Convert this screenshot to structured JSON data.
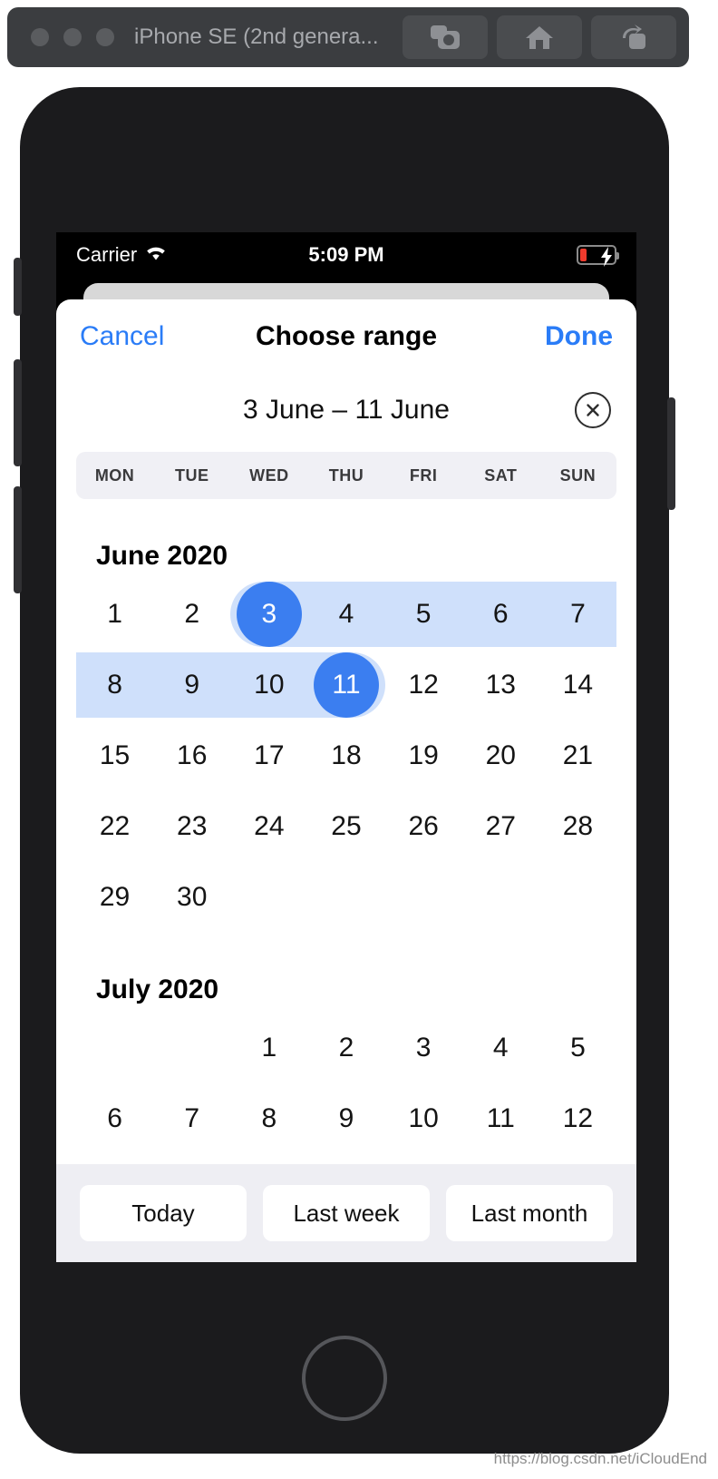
{
  "simulator": {
    "device_title": "iPhone SE (2nd genera...",
    "toolbar_buttons": [
      {
        "name": "screenshot-button",
        "icon": "camera-icon"
      },
      {
        "name": "home-button",
        "icon": "home-icon"
      },
      {
        "name": "rotate-button",
        "icon": "rotate-icon"
      }
    ]
  },
  "status_bar": {
    "carrier": "Carrier",
    "wifi_icon": "wifi-icon",
    "time": "5:09 PM",
    "battery_icon": "battery-charging-icon",
    "battery_color": "#f03b2d"
  },
  "modal": {
    "cancel_label": "Cancel",
    "title": "Choose range",
    "done_label": "Done",
    "range_text": "3 June – 11 June",
    "clear_icon": "close-circle-icon",
    "weekdays": [
      "MON",
      "TUE",
      "WED",
      "THU",
      "FRI",
      "SAT",
      "SUN"
    ],
    "accent_color": "#3b7ef0",
    "range_band_color": "#cfe0fb",
    "link_color": "#2a7cf7",
    "months": [
      {
        "title": "June 2020",
        "lead_blanks": 0,
        "weeks": [
          {
            "days": [
              "1",
              "2",
              "3",
              "4",
              "5",
              "6",
              "7"
            ],
            "band_start": 2,
            "band_end": 6
          },
          {
            "days": [
              "8",
              "9",
              "10",
              "11",
              "12",
              "13",
              "14"
            ],
            "band_start": 0,
            "band_end": 3
          },
          {
            "days": [
              "15",
              "16",
              "17",
              "18",
              "19",
              "20",
              "21"
            ]
          },
          {
            "days": [
              "22",
              "23",
              "24",
              "25",
              "26",
              "27",
              "28"
            ]
          },
          {
            "days": [
              "29",
              "30",
              "",
              "",
              "",
              "",
              ""
            ]
          }
        ],
        "start_day": "3",
        "end_day": "11"
      },
      {
        "title": "July 2020",
        "lead_blanks": 2,
        "weeks": [
          {
            "days": [
              "",
              "",
              "1",
              "2",
              "3",
              "4",
              "5"
            ]
          },
          {
            "days": [
              "6",
              "7",
              "8",
              "9",
              "10",
              "11",
              "12"
            ]
          }
        ]
      }
    ],
    "quick_buttons": [
      "Today",
      "Last week",
      "Last month"
    ]
  },
  "watermark": "https://blog.csdn.net/iCloudEnd"
}
